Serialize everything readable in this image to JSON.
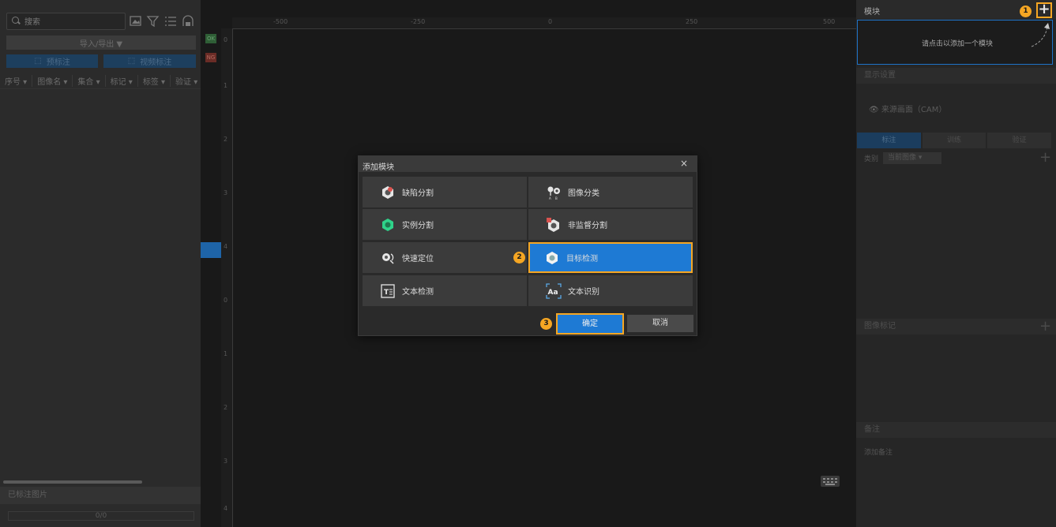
{
  "left_panel": {
    "search_placeholder": "搜索",
    "import_export": "导入/导出 ▼",
    "buttons": [
      "预标注",
      "视频标注"
    ],
    "columns": [
      "序号 ▾",
      "图像名 ▾",
      "集合 ▾",
      "标记 ▾",
      "标签 ▾",
      "验证 ▾"
    ],
    "labeled_images": "已标注图片",
    "progress": "0/0"
  },
  "canvas": {
    "ok_badge": "OK",
    "ng_badge": "NG",
    "ruler_top_labels": [
      "-500",
      "-250",
      "0",
      "250",
      "500"
    ],
    "ruler_left_labels": [
      "0",
      "1",
      "2",
      "3",
      "4",
      "0",
      "1",
      "2",
      "3",
      "4"
    ]
  },
  "right_panel": {
    "module_title": "模块",
    "add_button": "+",
    "module_hint": "请点击以添加一个模块",
    "display_settings": "显示设置",
    "display_source": "来源画面（CAM）",
    "tabs": [
      "标注",
      "训练",
      "验证"
    ],
    "class_label": "类别",
    "class_select": "当前图像",
    "image_marks": "图像标记",
    "notes": "备注",
    "add_note": "添加备注"
  },
  "dialog": {
    "title": "添加模块",
    "close": "×",
    "options": [
      {
        "label": "缺陷分割",
        "icon": "defect-segmentation-icon",
        "color": "#d9534f"
      },
      {
        "label": "图像分类",
        "icon": "image-classification-icon",
        "color": "#ffffff"
      },
      {
        "label": "实例分割",
        "icon": "instance-segmentation-icon",
        "color": "#2fd38a"
      },
      {
        "label": "非监督分割",
        "icon": "unsupervised-segmentation-icon",
        "color": "#d9534f"
      },
      {
        "label": "快速定位",
        "icon": "fast-positioning-icon",
        "color": "#ffffff"
      },
      {
        "label": "目标检测",
        "icon": "object-detection-icon",
        "color": "#ffffff"
      },
      {
        "label": "文本检测",
        "icon": "text-detection-icon",
        "color": "#ffffff"
      },
      {
        "label": "文本识别",
        "icon": "text-recognition-icon",
        "color": "#ffffff"
      }
    ],
    "selected": "目标检测",
    "confirm": "确定",
    "cancel": "取消"
  },
  "annotations": {
    "step1": "1",
    "step2": "2",
    "step3": "3",
    "highlight_color": "#f5a623"
  }
}
